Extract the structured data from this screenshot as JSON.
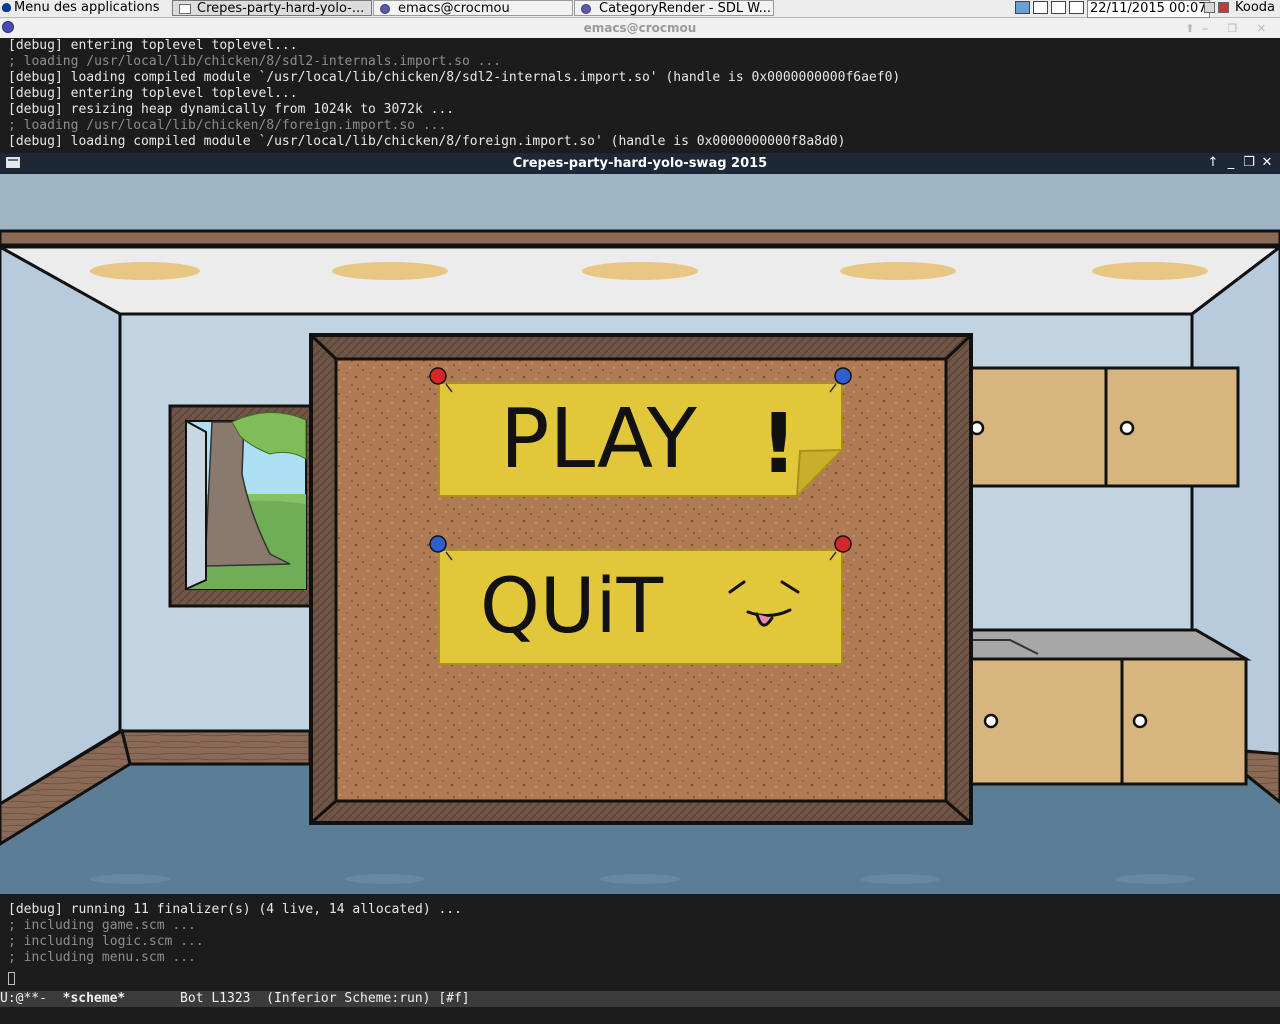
{
  "taskbar": {
    "menu_label": "Menu des applications",
    "tasks": [
      {
        "label": "Crepes-party-hard-yolo-..."
      },
      {
        "label": "emacs@crocmou"
      },
      {
        "label": "CategoryRender - SDL W..."
      }
    ],
    "clock": "22/11/2015 00:07",
    "user": "Kooda"
  },
  "emacs": {
    "title": "emacs@crocmou",
    "top_lines": [
      {
        "text": "[debug] entering toplevel toplevel...",
        "dim": false
      },
      {
        "text": "; loading /usr/local/lib/chicken/8/sdl2-internals.import.so ...",
        "dim": true
      },
      {
        "text": "[debug] loading compiled module `/usr/local/lib/chicken/8/sdl2-internals.import.so' (handle is 0x0000000000f6aef0)",
        "dim": false
      },
      {
        "text": "[debug] entering toplevel toplevel...",
        "dim": false
      },
      {
        "text": "[debug] resizing heap dynamically from 1024k to 3072k ...",
        "dim": false
      },
      {
        "text": "; loading /usr/local/lib/chicken/8/foreign.import.so ...",
        "dim": true
      },
      {
        "text": "[debug] loading compiled module `/usr/local/lib/chicken/8/foreign.import.so' (handle is 0x0000000000f8a8d0)",
        "dim": false
      }
    ],
    "bottom_lines": [
      {
        "text": "[debug] running 11 finalizer(s) (4 live, 14 allocated) ...",
        "dim": false
      },
      {
        "text": "; including game.scm ...",
        "dim": true
      },
      {
        "text": "; including logic.scm ...",
        "dim": true
      },
      {
        "text": "; including menu.scm ...",
        "dim": true
      }
    ],
    "modeline": {
      "status": "U:@**-  ",
      "buffer": "*scheme*",
      "position": "       Bot L1323  ",
      "mode": "(Inferior Scheme:run) [#f]"
    }
  },
  "game": {
    "title": "Crepes-party-hard-yolo-swag 2015",
    "play_label": "PLAY",
    "play_mark": "!",
    "quit_label": "QUiT"
  },
  "colors": {
    "sky": "#9fb6c6",
    "wall": "#c2d3e2",
    "floor": "#5c7d96",
    "cork": "#b07b54",
    "note": "#e3c73a",
    "cabinet": "#d6b57e"
  }
}
